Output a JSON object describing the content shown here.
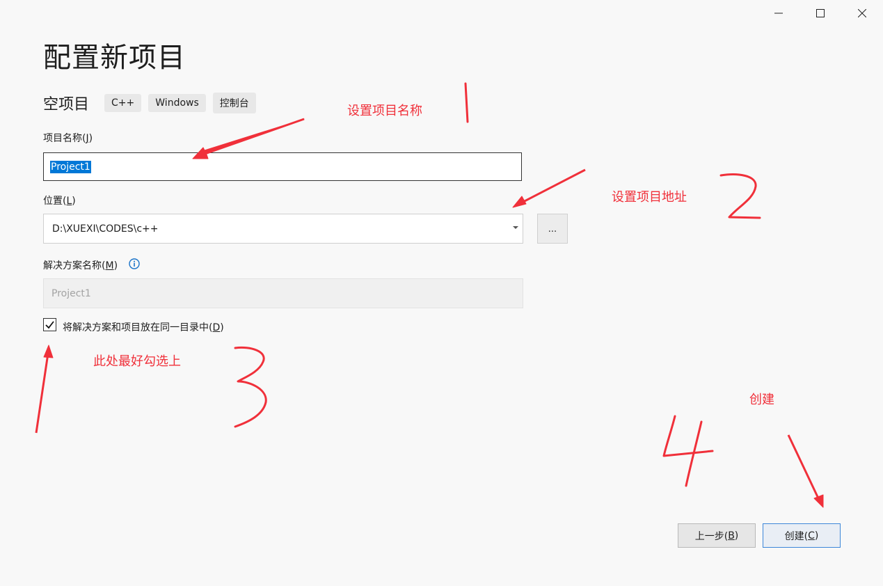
{
  "window": {
    "minimize": "minimize",
    "maximize": "maximize",
    "close": "close"
  },
  "page": {
    "title": "配置新项目",
    "subtitle": "空项目",
    "tags": [
      "C++",
      "Windows",
      "控制台"
    ]
  },
  "form": {
    "name_label": "项目名称(",
    "name_label_key": "J",
    "name_label_end": ")",
    "name_value": "Project1",
    "location_label": "位置(",
    "location_label_key": "L",
    "location_label_end": ")",
    "location_value": "D:\\XUEXI\\CODES\\c++",
    "browse_label": "...",
    "solution_label": "解决方案名称(",
    "solution_label_key": "M",
    "solution_label_end": ")",
    "solution_placeholder": "Project1",
    "same_dir_label": "将解决方案和项目放在同一目录中(",
    "same_dir_key": "D",
    "same_dir_end": ")",
    "same_dir_checked": true
  },
  "buttons": {
    "back": "上一步(",
    "back_key": "B",
    "back_end": ")",
    "create": "创建(",
    "create_key": "C",
    "create_end": ")"
  },
  "annotations": {
    "a1": "设置项目名称",
    "a2": "设置项目地址",
    "a3": "此处最好勾选上",
    "a4": "创建"
  },
  "colors": {
    "annotation": "#f0303a",
    "selection": "#0078d7",
    "accent_border": "#3c86d9"
  }
}
